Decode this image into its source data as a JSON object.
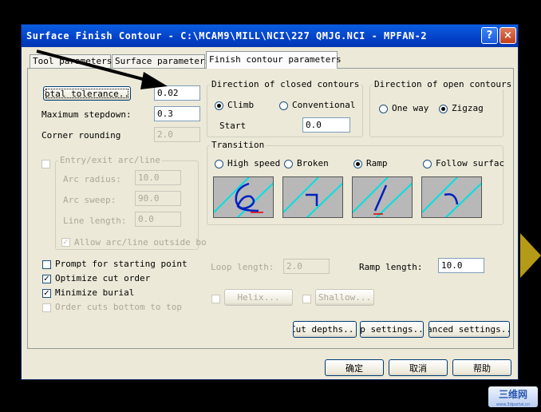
{
  "window": {
    "title": "Surface Finish Contour - C:\\MCAM9\\MILL\\NCI\\227 QMJG.NCI - MPFAN-2",
    "help_glyph": "?",
    "close_glyph": "×"
  },
  "tabs": [
    {
      "label": "Tool parameters"
    },
    {
      "label": "Surface parameters"
    },
    {
      "label": "Finish contour parameters",
      "active": true
    }
  ],
  "fields": {
    "total_tolerance_button": "Total tolerance...",
    "total_tolerance": "0.02",
    "max_stepdown_label": "Maximum stepdown:",
    "max_stepdown": "0.3",
    "corner_rounding_label": "Corner rounding",
    "corner_rounding": "2.0"
  },
  "entry_exit": {
    "label": "Entry/exit arc/line",
    "arc_radius_label": "Arc radius:",
    "arc_radius": "10.0",
    "arc_sweep_label": "Arc sweep:",
    "arc_sweep": "90.0",
    "line_length_label": "Line length:",
    "line_length": "0.0",
    "allow_label": "Allow arc/line outside bo",
    "check_glyph": "✓"
  },
  "closed_contours": {
    "label": "Direction of closed contours",
    "climb": "Climb",
    "conventional": "Conventional",
    "start_label": "Start",
    "start_value": "0.0"
  },
  "open_contours": {
    "label": "Direction of open contours",
    "one_way": "One way",
    "zigzag": "Zigzag"
  },
  "transition": {
    "label": "Transition",
    "high_speed": "High speed",
    "broken": "Broken",
    "ramp": "Ramp",
    "follow_surface": "Follow surfac"
  },
  "loop_length_label": "Loop length:",
  "loop_length": "2.0",
  "ramp_length_label": "Ramp length:",
  "ramp_length": "10.0",
  "helix_button": "Helix...",
  "shallow_button": "Shallow...",
  "options": {
    "prompt_start": "Prompt for starting point",
    "optimize_cut_order": "Optimize cut order",
    "minimize_burial": "Minimize burial",
    "order_cuts": "Order cuts bottom to top",
    "check_glyph": "✓"
  },
  "buttons": {
    "cut_depths": "Cut depths...",
    "gap_settings": "ap settings...",
    "advanced_settings": "vanced settings...",
    "ok": "确定",
    "cancel": "取消",
    "help": "帮助"
  },
  "watermark": {
    "text": "三维网",
    "url": "www.3dportal.cn"
  }
}
